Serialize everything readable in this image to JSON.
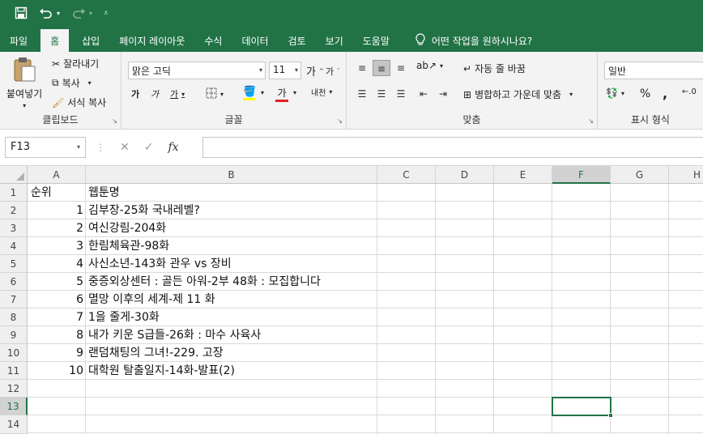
{
  "quick_access": {
    "save_icon": "save-icon",
    "undo_icon": "undo-icon",
    "redo_icon": "redo-icon",
    "customize_icon": "customize-qat-icon"
  },
  "tabs": [
    {
      "label": "파일"
    },
    {
      "label": "홈"
    },
    {
      "label": "삽입"
    },
    {
      "label": "페이지 레이아웃"
    },
    {
      "label": "수식"
    },
    {
      "label": "데이터"
    },
    {
      "label": "검토"
    },
    {
      "label": "보기"
    },
    {
      "label": "도움말"
    }
  ],
  "tell_me": "어떤 작업을 원하시나요?",
  "ribbon": {
    "clipboard": {
      "label": "클립보드",
      "paste": "붙여넣기",
      "cut": "잘라내기",
      "copy": "복사",
      "format_painter": "서식 복사"
    },
    "font": {
      "label": "글꼴",
      "font_name": "맑은 고딕",
      "font_size": "11",
      "grow": "가",
      "shrink": "가",
      "bold": "가",
      "italic": "가",
      "underline": "가",
      "font_color_glyph": "가",
      "phonetic": "내천"
    },
    "alignment": {
      "label": "맞춤",
      "wrap_text": "자동 줄 바꿈",
      "merge_center": "병합하고 가운데 맞춤"
    },
    "number": {
      "label": "표시 형식",
      "format": "일반",
      "percent": "%",
      "comma": ","
    }
  },
  "formula_bar": {
    "name_box": "F13",
    "cancel": "✕",
    "enter": "✓",
    "fx": "fx",
    "value": ""
  },
  "columns": [
    "A",
    "B",
    "C",
    "D",
    "E",
    "F",
    "G",
    "H"
  ],
  "active_column": "F",
  "rows": [
    "1",
    "2",
    "3",
    "4",
    "5",
    "6",
    "7",
    "8",
    "9",
    "10",
    "11",
    "12",
    "13",
    "14"
  ],
  "active_row": "13",
  "cells": {
    "header": {
      "a": "순위",
      "b": "웹툰명"
    },
    "data": [
      {
        "rank": "1",
        "title": "김부장-25화 국내레벨?"
      },
      {
        "rank": "2",
        "title": "여신강림-204화"
      },
      {
        "rank": "3",
        "title": "한림체육관-98화"
      },
      {
        "rank": "4",
        "title": "사신소년-143화 관우 vs 장비"
      },
      {
        "rank": "5",
        "title": "중증외상센터 : 골든 아워-2부 48화 : 모집합니다"
      },
      {
        "rank": "6",
        "title": "멸망 이후의 세계-제 11 화"
      },
      {
        "rank": "7",
        "title": "1을 줄게-30화"
      },
      {
        "rank": "8",
        "title": "내가 키운 S급들-26화 : 마수 사육사"
      },
      {
        "rank": "9",
        "title": "랜덤채팅의 그녀!-229. 고장"
      },
      {
        "rank": "10",
        "title": "대학원 탈출일지-14화-발표(2)"
      }
    ]
  },
  "colors": {
    "excel_green": "#217346",
    "ribbon_bg": "#f3f3f3"
  }
}
